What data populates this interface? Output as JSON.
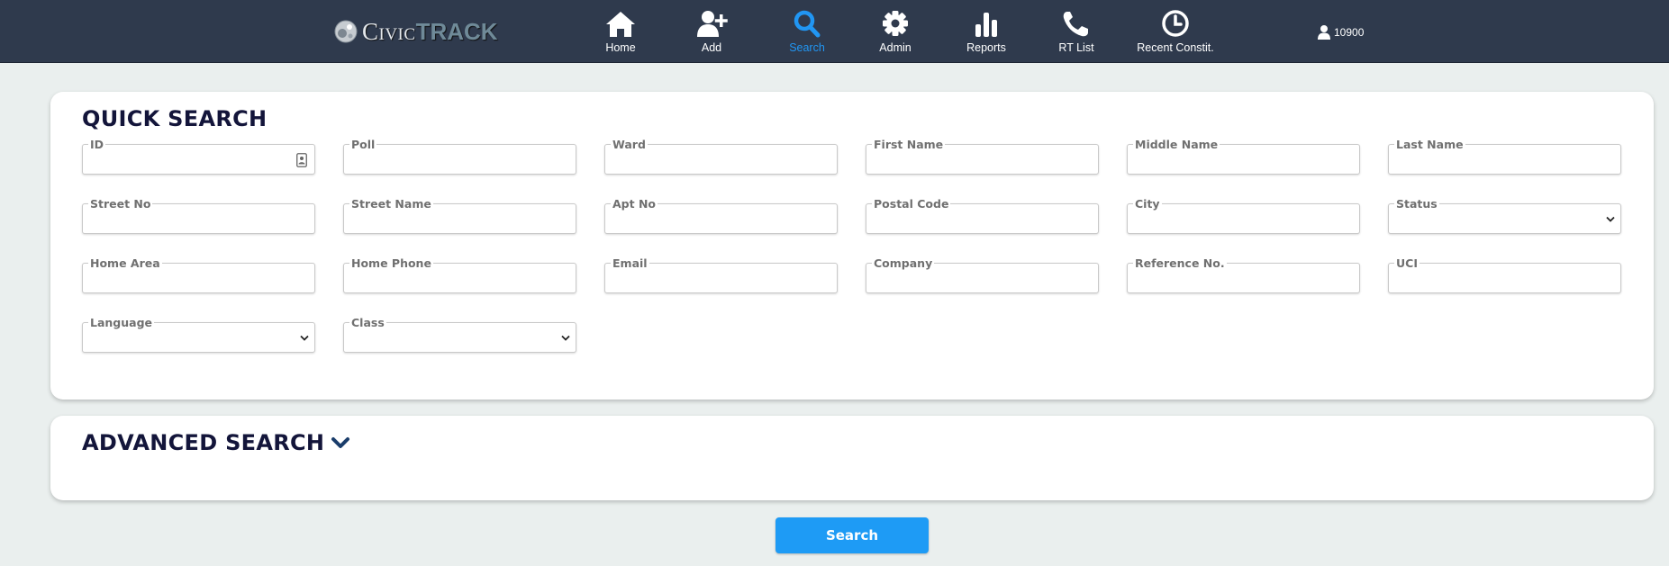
{
  "brand": {
    "civic": "Civic",
    "track": "TRACK"
  },
  "nav": {
    "home": "Home",
    "add": "Add",
    "search": "Search",
    "admin": "Admin",
    "reports": "Reports",
    "rt_list": "RT List",
    "recent": "Recent Constit."
  },
  "active_nav": "search",
  "user": {
    "id": "10900"
  },
  "quick_search": {
    "title": "QUICK SEARCH",
    "fields": {
      "id": "ID",
      "poll": "Poll",
      "ward": "Ward",
      "first_name": "First Name",
      "middle_name": "Middle Name",
      "last_name": "Last Name",
      "street_no": "Street No",
      "street_name": "Street Name",
      "apt_no": "Apt No",
      "postal_code": "Postal Code",
      "city": "City",
      "status": "Status",
      "home_area": "Home Area",
      "home_phone": "Home Phone",
      "email": "Email",
      "company": "Company",
      "reference_no": "Reference No.",
      "uci": "UCI",
      "language": "Language",
      "class": "Class"
    }
  },
  "advanced_search": {
    "title": "ADVANCED SEARCH"
  },
  "actions": {
    "search": "Search"
  },
  "colors": {
    "nav_bg": "#2f3a4d",
    "accent": "#1e9bf5",
    "page_bg": "#eaefee",
    "title": "#13153a"
  }
}
